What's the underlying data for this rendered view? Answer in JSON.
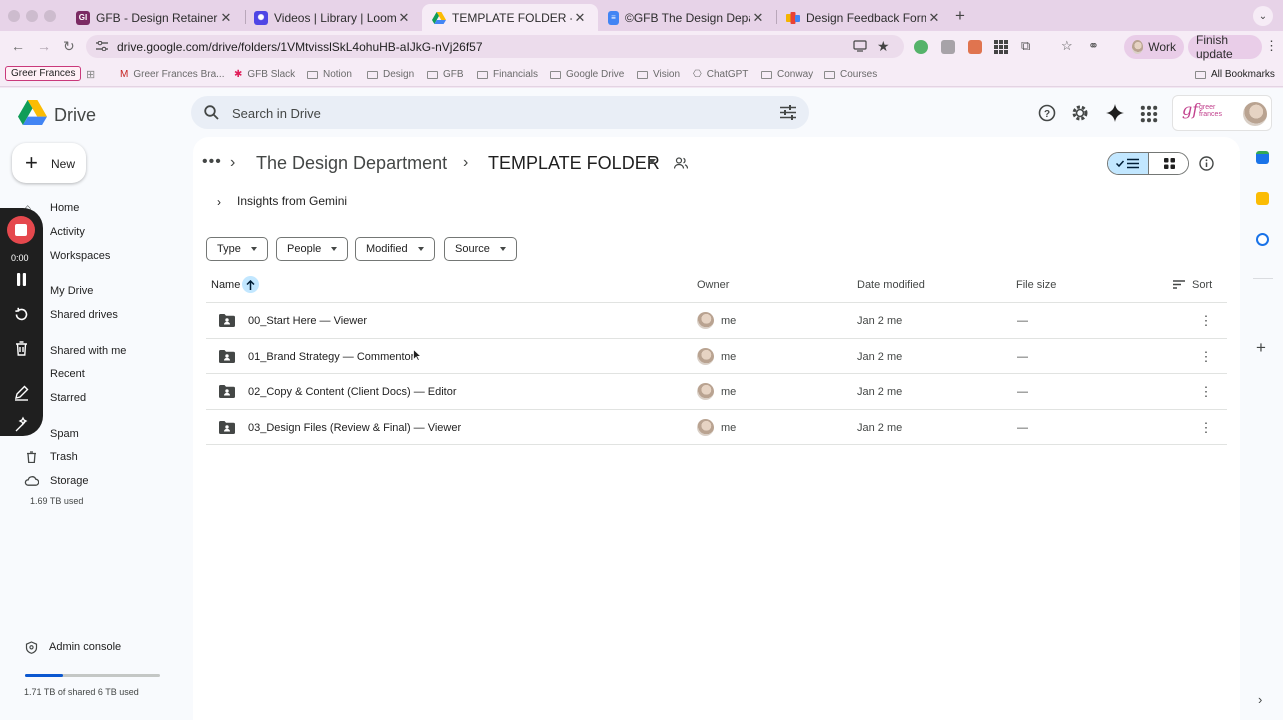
{
  "browser": {
    "tabs": [
      {
        "label": "GFB - Design Retainer Manag",
        "icon": "gfb-favicon",
        "color": "#7b2b63"
      },
      {
        "label": "Videos | Library | Loom",
        "icon": "loom-favicon",
        "color": "#4f46e5"
      },
      {
        "label": "TEMPLATE FOLDER - Google",
        "icon": "drive-favicon",
        "active": true
      },
      {
        "label": "©GFB The Design Departmen",
        "icon": "docs-favicon",
        "color": "#4285f4"
      },
      {
        "label": "Design Feedback Form",
        "icon": "forms-favicon",
        "color": "#7248b9"
      }
    ],
    "url": "drive.google.com/drive/folders/1VMtvisslSkL4ohuHB-aIJkG-nVj26f57",
    "profile_label": "Work",
    "update_label": "Finish update",
    "bookmarks": [
      "Greer Frances",
      "Greer Frances Bra...",
      "GFB Slack",
      "Notion",
      "Design",
      "GFB",
      "Financials",
      "Google Drive",
      "Vision",
      "ChatGPT",
      "Conway",
      "Courses"
    ],
    "all_bookmarks": "All Bookmarks"
  },
  "drive": {
    "app_name": "Drive",
    "search_placeholder": "Search in Drive",
    "new_label": "New",
    "brand_text": "gf",
    "brand_sub": "greer frances",
    "nav": [
      {
        "label": "Home",
        "icon": "home-icon"
      },
      {
        "label": "Activity",
        "icon": "activity-icon"
      },
      {
        "label": "Workspaces",
        "icon": "workspaces-icon"
      },
      {
        "label": "My Drive",
        "icon": "my-drive-icon"
      },
      {
        "label": "Shared drives",
        "icon": "shared-drives-icon"
      },
      {
        "label": "Shared with me",
        "icon": "shared-with-me-icon"
      },
      {
        "label": "Recent",
        "icon": "recent-icon"
      },
      {
        "label": "Starred",
        "icon": "starred-icon"
      },
      {
        "label": "Spam",
        "icon": "spam-icon"
      },
      {
        "label": "Trash",
        "icon": "trash-icon"
      },
      {
        "label": "Storage",
        "icon": "cloud-icon"
      }
    ],
    "storage_used": "1.69 TB used",
    "admin_console": "Admin console",
    "shared_storage": {
      "label": "1.71 TB of shared 6 TB used",
      "fraction": 0.285
    },
    "loom": {
      "timer": "0:00"
    },
    "breadcrumb": {
      "parent": "The Design Department",
      "current": "TEMPLATE FOLDER"
    },
    "gemini_label": "Insights from Gemini",
    "filters": [
      "Type",
      "People",
      "Modified",
      "Source"
    ],
    "columns": {
      "name": "Name",
      "owner": "Owner",
      "date_modified": "Date modified",
      "file_size": "File size",
      "sort": "Sort"
    },
    "rows": [
      {
        "name": "00_Start Here — Viewer",
        "owner": "me",
        "date": "Jan 2 me",
        "size": "—"
      },
      {
        "name": "01_Brand Strategy — Commentor",
        "owner": "me",
        "date": "Jan 2 me",
        "size": "—"
      },
      {
        "name": "02_Copy & Content (Client Docs) — Editor",
        "owner": "me",
        "date": "Jan 2 me",
        "size": "—"
      },
      {
        "name": "03_Design Files (Review & Final) — Viewer",
        "owner": "me",
        "date": "Jan 2 me",
        "size": "—"
      }
    ]
  },
  "colors": {
    "accent": "#0b57d0",
    "selected": "#c2e7ff",
    "loom_red": "#e5484d",
    "brand_pink": "#c2418d"
  }
}
